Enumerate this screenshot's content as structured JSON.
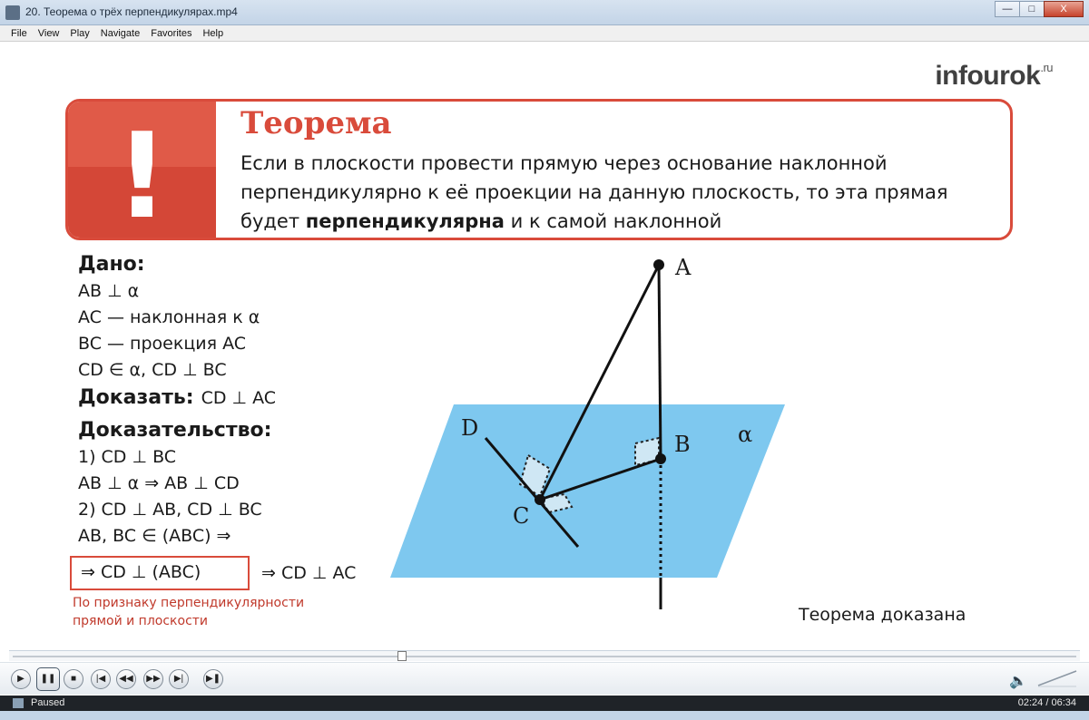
{
  "window": {
    "title": "20. Теорема о трёх перпендикулярах.mp4",
    "min_label": "—",
    "max_label": "□",
    "close_label": "X"
  },
  "menu": [
    "File",
    "View",
    "Play",
    "Navigate",
    "Favorites",
    "Help"
  ],
  "slide": {
    "logo_text": "infourok",
    "logo_domain": ".ru",
    "theorem_title": "Теорема",
    "theorem_text_1": "Если в плоскости провести прямую через основание наклонной перпендикулярно к её проекции на данную плоскость, то эта прямая будет ",
    "theorem_text_bold": "перпендикулярна",
    "theorem_text_2": " и к самой наклонной",
    "given_heading": "Дано:",
    "given_lines": [
      "AB ⊥ α",
      "AC — наклонная к α",
      "BC — проекция AC",
      "CD ∈ α,   CD ⊥ BC"
    ],
    "prove_label": "Доказать:",
    "prove_value": "CD ⊥ AC",
    "proof_heading": "Доказательство:",
    "proof_lines": [
      "1) CD ⊥ BC",
      "AB ⊥ α  ⇒ AB ⊥ CD",
      "2) CD ⊥ AB, CD ⊥ BC",
      "AB, BC ∈ (ABC) ⇒"
    ],
    "conclusion_boxed": "⇒ CD ⊥ (ABC)",
    "conclusion_right": "⇒ CD ⊥ AC",
    "note_line_1": "По признаку перпендикулярности",
    "note_line_2": "прямой и плоскости",
    "proved_text": "Теорема доказана",
    "labels": {
      "A": "A",
      "B": "B",
      "C": "C",
      "D": "D",
      "alpha": "α"
    },
    "colors": {
      "accent": "#d94b3b",
      "plane": "#7ec8ef"
    }
  },
  "player": {
    "status": "Paused",
    "time": "02:24 / 06:34",
    "progress_fraction": 0.366,
    "buttons": {
      "play": "▶",
      "pause": "❚❚",
      "stop": "■",
      "prev": "|◀",
      "rewind": "◀◀",
      "forward": "▶▶",
      "next": "▶|",
      "step": "▶❚"
    },
    "volume_icon": "🔈"
  }
}
